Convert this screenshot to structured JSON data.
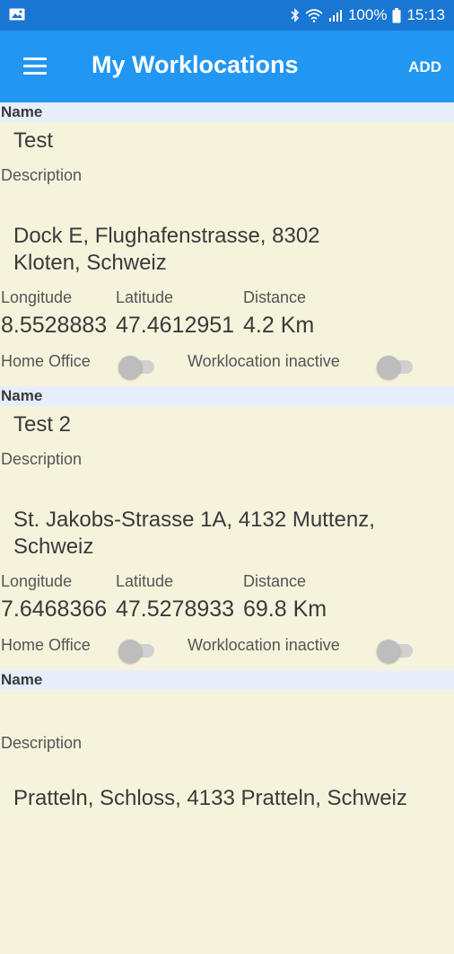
{
  "status_bar": {
    "battery": "100%",
    "time": "15:13"
  },
  "app_bar": {
    "title": "My Worklocations",
    "add_label": "ADD"
  },
  "labels": {
    "name": "Name",
    "description": "Description",
    "longitude": "Longitude",
    "latitude": "Latitude",
    "distance": "Distance",
    "home_office": "Home Office",
    "inactive": "Worklocation inactive"
  },
  "locations": [
    {
      "name": "Test",
      "address_line1": "Dock E, Flughafenstrasse, 8302",
      "address_line2": "Kloten, Schweiz",
      "longitude": "8.5528883",
      "latitude": "47.4612951",
      "distance": "4.2 Km",
      "home_office": false,
      "inactive": false
    },
    {
      "name": "Test 2",
      "address_line1": "St. Jakobs-Strasse 1A, 4132 Muttenz,",
      "address_line2": "Schweiz",
      "longitude": "7.6468366",
      "latitude": "47.5278933",
      "distance": "69.8 Km",
      "home_office": false,
      "inactive": false
    },
    {
      "name": "",
      "address_line1": "Pratteln, Schloss, 4133 Pratteln, Schweiz",
      "address_line2": ""
    }
  ]
}
